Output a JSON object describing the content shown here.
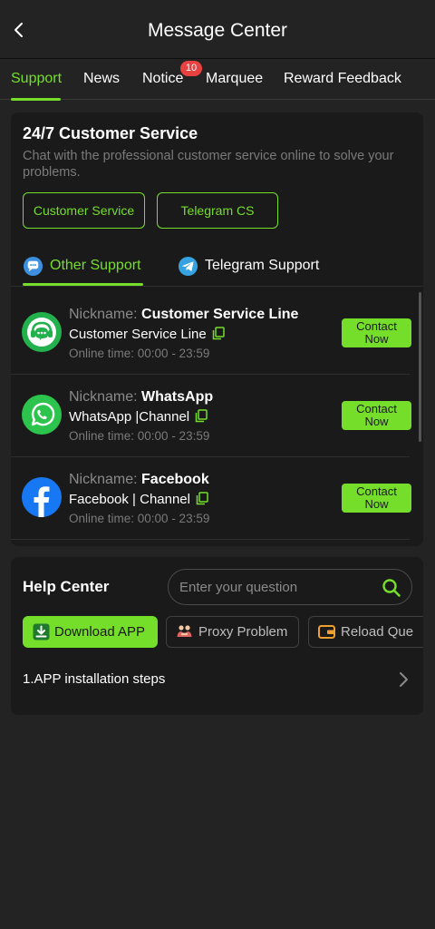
{
  "header": {
    "title": "Message Center"
  },
  "tabs": [
    {
      "label": "Support"
    },
    {
      "label": "News"
    },
    {
      "label": "Notice",
      "badge": "10"
    },
    {
      "label": "Marquee"
    },
    {
      "label": "Reward Feedback"
    }
  ],
  "customer_service": {
    "title": "24/7 Customer Service",
    "description": "Chat with the professional customer service online to solve your problems.",
    "buttons": [
      {
        "label": "Customer Service"
      },
      {
        "label": "Telegram CS"
      }
    ]
  },
  "support_tabs": [
    {
      "label": "Other Support",
      "icon": "chat-bubble-icon"
    },
    {
      "label": "Telegram Support",
      "icon": "telegram-icon"
    }
  ],
  "support_items": [
    {
      "nickname_prefix": "Nickname:",
      "nickname": "Customer Service Line",
      "channel": "Customer Service Line",
      "online_time": "Online time:  00:00 - 23:59",
      "action": "Contact Now",
      "icon": "headset-icon"
    },
    {
      "nickname_prefix": "Nickname:",
      "nickname": "WhatsApp",
      "channel": "WhatsApp |Channel",
      "online_time": "Online time:  00:00 - 23:59",
      "action": "Contact Now",
      "icon": "whatsapp-icon"
    },
    {
      "nickname_prefix": "Nickname:",
      "nickname": "Facebook",
      "channel": "Facebook | Channel",
      "online_time": "Online time:  00:00 - 23:59",
      "action": "Contact Now",
      "icon": "facebook-icon"
    }
  ],
  "help_center": {
    "title": "Help Center",
    "search_placeholder": "Enter your question",
    "chips": [
      {
        "label": "Download APP"
      },
      {
        "label": "Proxy Problem"
      },
      {
        "label": "Reload Que"
      }
    ],
    "items": [
      {
        "label": "1.APP installation steps"
      }
    ]
  },
  "colors": {
    "accent": "#75de2b",
    "background": "#232323",
    "card": "#1a1a1a",
    "badge": "#e74141"
  }
}
